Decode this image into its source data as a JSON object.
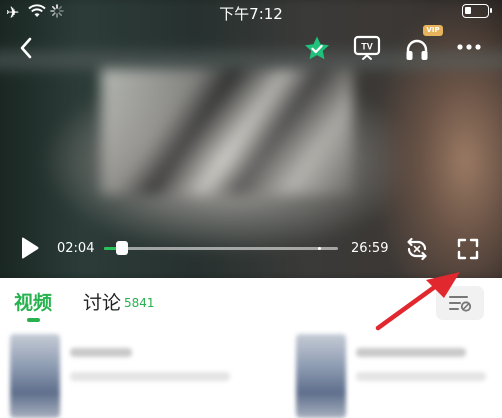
{
  "status_bar": {
    "time": "下午7:12",
    "icons": [
      "airplane-icon",
      "wifi-icon",
      "loading-spinner-icon",
      "battery-icon"
    ]
  },
  "player": {
    "top_icons": [
      "back-arrow-icon",
      "favorite-star-icon",
      "tv-cast-icon",
      "audio-headphones-icon",
      "more-icon"
    ],
    "vip_badge": "VIP",
    "current_time": "02:04",
    "total_time": "26:59",
    "progress_fraction": 0.077,
    "bottom_icons": [
      "play-icon",
      "switch-icon",
      "fullscreen-icon"
    ],
    "accent_color": "#27c45a",
    "favorite_color": "#1ec27a"
  },
  "tabs": {
    "video_label": "视频",
    "discuss_label": "讨论",
    "discuss_count": "5841",
    "active_color": "#27b24f"
  },
  "filter_button": {
    "icon": "list-filter-icon"
  },
  "annotation": {
    "color": "#e0282e"
  }
}
